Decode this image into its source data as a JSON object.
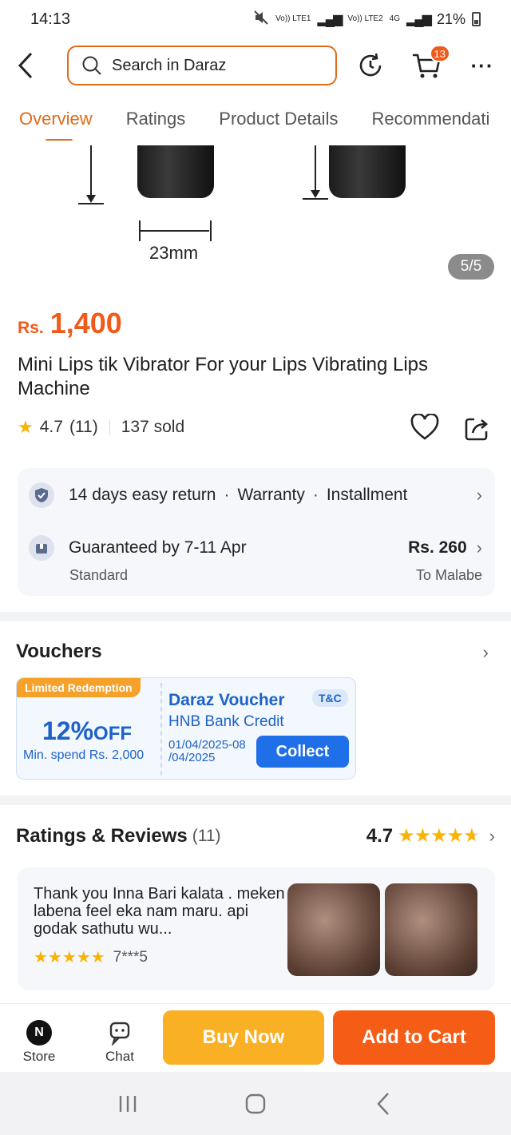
{
  "status_bar": {
    "time": "14:13",
    "sim1": "Vo)) LTE1",
    "sim2": "Vo)) LTE2",
    "net_type": "4G",
    "battery": "21%"
  },
  "header": {
    "search_placeholder": "Search in Daraz",
    "cart_count": "13"
  },
  "tabs": [
    {
      "label": "Overview",
      "active": true
    },
    {
      "label": "Ratings",
      "active": false
    },
    {
      "label": "Product Details",
      "active": false
    },
    {
      "label": "Recommendati",
      "active": false
    }
  ],
  "gallery": {
    "dimension_label": "23mm",
    "page_indicator": "5/5"
  },
  "product": {
    "currency": "Rs.",
    "price": "1,400",
    "title": "Mini Lips tik Vibrator For your Lips Vibrating Lips Machine",
    "rating": "4.7",
    "rating_count": "(11)",
    "sold": "137 sold"
  },
  "services": {
    "return": "14 days easy return",
    "warranty": "Warranty",
    "installment": "Installment",
    "delivery": "Guaranteed by 7-11 Apr",
    "delivery_type": "Standard",
    "ship_fee": "Rs. 260",
    "ship_to": "To Malabe"
  },
  "vouchers": {
    "section_title": "Vouchers",
    "ribbon": "Limited Redemption",
    "discount": "12%",
    "discount_suffix": "OFF",
    "min_spend": "Min. spend Rs. 2,000",
    "name": "Daraz Voucher",
    "bank": "HNB Bank Credit",
    "tc": "T&C",
    "date": "01/04/2025-08 /04/2025",
    "collect_label": "Collect"
  },
  "reviews": {
    "section_title": "Ratings & Reviews",
    "count": "(11)",
    "score": "4.7",
    "review_text": "Thank you Inna Bari kalata . meken labena feel eka nam maru. api godak sathutu wu...",
    "review_user": "7***5",
    "review_stars": 5
  },
  "bottom_bar": {
    "store_label": "Store",
    "chat_label": "Chat",
    "buy_now_label": "Buy Now",
    "add_to_cart_label": "Add to Cart"
  },
  "colors": {
    "accent_orange": "#e26b18",
    "price_orange": "#f05a1a",
    "voucher_blue": "#1d62c6",
    "buy_now": "#f9b024",
    "add_to_cart": "#f55d17",
    "star": "#f8b400"
  }
}
